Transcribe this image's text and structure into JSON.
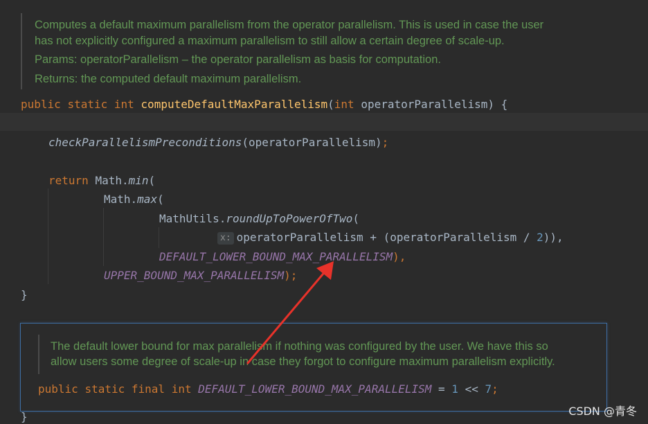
{
  "doc": {
    "line1": "Computes a default maximum parallelism from the operator parallelism. This is used in case the user",
    "line2": "has not explicitly configured a maximum parallelism to still allow a certain degree of scale-up.",
    "params_label": "Params:",
    "params_text": "operatorParallelism – the operator parallelism as basis for computation.",
    "returns_label": "Returns:",
    "returns_text": "the computed default maximum parallelism."
  },
  "code": {
    "kw_public": "public",
    "kw_static": "static",
    "kw_int": "int",
    "method_name": "computeDefaultMaxParallelism",
    "param_name": "operatorParallelism",
    "open_brace": ") {",
    "check_call": "checkParallelismPreconditions",
    "check_arg": "(operatorParallelism)",
    "semicolon": ";",
    "kw_return": "return",
    "math": "Math.",
    "min": "min",
    "max": "max",
    "open_paren": "(",
    "math_utils": "MathUtils.",
    "round_up": "roundUpToPowerOfTwo",
    "hint_x": "x:",
    "expr": "operatorParallelism + (operatorParallelism / ",
    "two": "2",
    "expr_close": ")),",
    "default_lower": "DEFAULT_LOWER_BOUND_MAX_PARALLELISM",
    "comma_close": "),",
    "upper": "UPPER_BOUND_MAX_PARALLELISM",
    "upper_close": ");",
    "close_brace": "}"
  },
  "popup": {
    "doc_line1": "The default lower bound for max parallelism if nothing was configured by the user. We have this so",
    "doc_line2": "allow users some degree of scale-up in case they forgot to configure maximum parallelism explicitly.",
    "kw_public": "public",
    "kw_static": "static",
    "kw_final": "final",
    "kw_int": "int",
    "const_name": "DEFAULT_LOWER_BOUND_MAX_PARALLELISM",
    "equals": " = ",
    "one": "1",
    "shift": " << ",
    "seven": "7",
    "semicolon": ";"
  },
  "watermark": "CSDN @青冬",
  "colors": {
    "background": "#2b2b2b",
    "keyword": "#cc7832",
    "method": "#ffc66d",
    "constant": "#9876aa",
    "number": "#6897bb",
    "doc_comment": "#629755",
    "annotation_arrow": "#e8322a",
    "popup_border": "#3e6ea4"
  }
}
